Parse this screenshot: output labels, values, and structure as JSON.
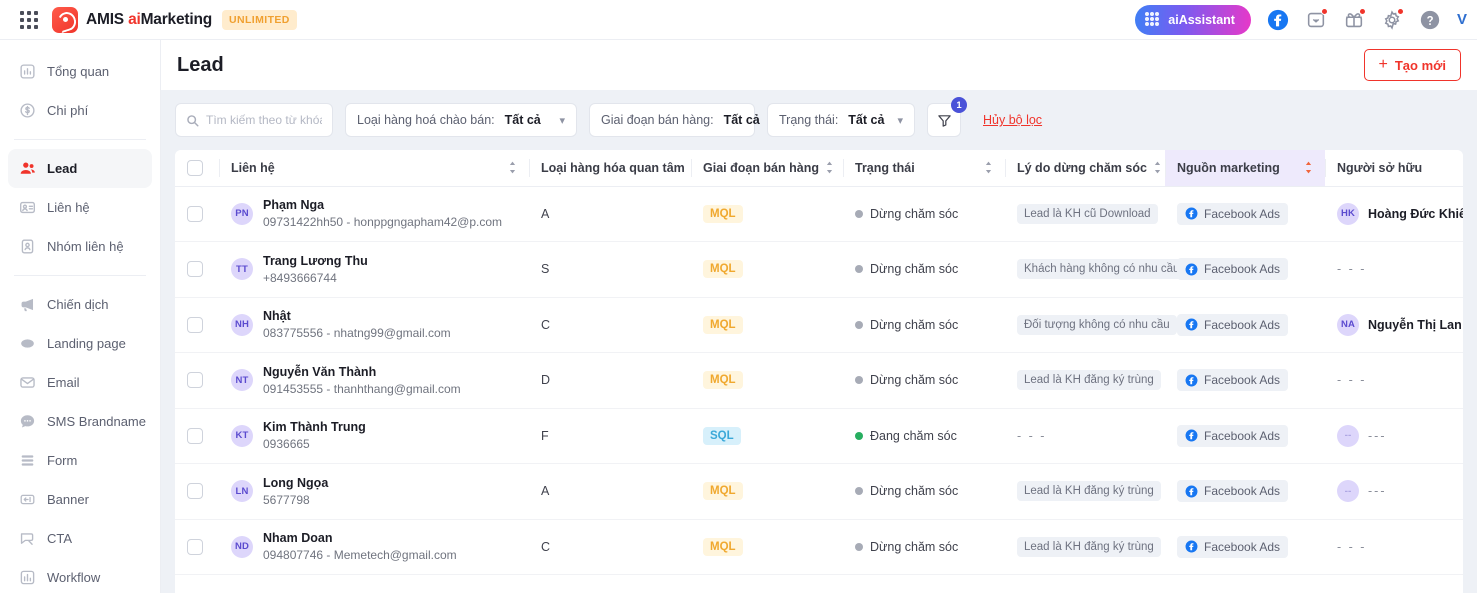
{
  "topbar": {
    "grid_icon": "apps-grid-icon",
    "brand_amis": "AMIS ",
    "brand_ai": "ai",
    "brand_marketing": "Marketing",
    "plan_badge": "UNLIMITED",
    "assistant_label": "aiAssistant",
    "icons": [
      "facebook-icon",
      "inbox-icon",
      "gift-icon",
      "gear-icon",
      "help-icon"
    ],
    "user_initial": "V"
  },
  "sidebar": {
    "items": [
      {
        "label": "Tổng quan",
        "icon": "chart-bar-icon",
        "active": false
      },
      {
        "label": "Chi phí",
        "icon": "dollar-circle-icon",
        "active": false
      },
      {
        "label": "Lead",
        "icon": "users-icon",
        "active": true
      },
      {
        "label": "Liên hệ",
        "icon": "contact-card-icon",
        "active": false
      },
      {
        "label": "Nhóm liên hệ",
        "icon": "address-book-icon",
        "active": false
      },
      {
        "label": "Chiến dịch",
        "icon": "megaphone-icon",
        "active": false
      },
      {
        "label": "Landing page",
        "icon": "globe-icon",
        "active": false
      },
      {
        "label": "Email",
        "icon": "envelope-icon",
        "active": false
      },
      {
        "label": "SMS Brandname",
        "icon": "chat-bubble-icon",
        "active": false
      },
      {
        "label": "Form",
        "icon": "form-lines-icon",
        "active": false
      },
      {
        "label": "Banner",
        "icon": "banner-icon",
        "active": false
      },
      {
        "label": "CTA",
        "icon": "cta-cursor-icon",
        "active": false
      },
      {
        "label": "Workflow",
        "icon": "workflow-icon",
        "active": false
      }
    ]
  },
  "page": {
    "title": "Lead",
    "create_button": "Tạo mới",
    "create_plus": "+"
  },
  "filters": {
    "search_placeholder": "Tìm kiếm theo từ khóa",
    "search_value": "",
    "selects": [
      {
        "label": "Loại hàng hoá chào bán:",
        "value": "Tất cả"
      },
      {
        "label": "Giai đoạn bán hàng:",
        "value": "Tất cả"
      },
      {
        "label": "Trạng thái:",
        "value": "Tất cả"
      }
    ],
    "filter_badge": "1",
    "clear_label": "Hủy bộ lọc"
  },
  "table": {
    "columns": [
      "Liên hệ",
      "Loại hàng hóa quan tâm",
      "Giai đoạn bán hàng",
      "Trạng thái",
      "Lý do dừng chăm sóc",
      "Nguồn marketing",
      "Người sở hữu"
    ],
    "highlighted_column": "Nguồn marketing",
    "rows": [
      {
        "initials": "PN",
        "name": "Phạm Nga",
        "sub": "09731422hh50 - honppgngapham42@p.com",
        "product": "A",
        "stage": "MQL",
        "stage_type": "mql",
        "status": "Dừng chăm sóc",
        "status_color": "#a7abb6",
        "reason": "Lead là KH cũ Download",
        "source": "Facebook Ads",
        "owner": "Hoàng Đức Khiêm",
        "owner_initials": "HK"
      },
      {
        "initials": "TT",
        "name": "Trang Lương Thu",
        "sub": "+8493666744",
        "product": "S",
        "stage": "MQL",
        "stage_type": "mql",
        "status": "Dừng chăm sóc",
        "status_color": "#a7abb6",
        "reason": "Khách hàng không có nhu cầu",
        "source": "Facebook Ads",
        "owner": "- - -",
        "owner_initials": ""
      },
      {
        "initials": "NH",
        "name": "Nhật",
        "sub": "083775556 - nhatng99@gmail.com",
        "product": "C",
        "stage": "MQL",
        "stage_type": "mql",
        "status": "Dừng chăm sóc",
        "status_color": "#a7abb6",
        "reason": "Đối tượng không có nhu cầu",
        "source": "Facebook Ads",
        "owner": "Nguyễn Thị Lan Anh",
        "owner_initials": "NA"
      },
      {
        "initials": "NT",
        "name": "Nguyễn Văn Thành",
        "sub": "091453555 - thanhthang@gmail.com",
        "product": "D",
        "stage": "MQL",
        "stage_type": "mql",
        "status": "Dừng chăm sóc",
        "status_color": "#a7abb6",
        "reason": "Lead là KH đăng ký trùng",
        "source": "Facebook Ads",
        "owner": "- - -",
        "owner_initials": ""
      },
      {
        "initials": "KT",
        "name": "Kim Thành Trung",
        "sub": "0936665",
        "product": "F",
        "stage": "SQL",
        "stage_type": "sql",
        "status": "Đang chăm sóc",
        "status_color": "#27ae60",
        "reason": "- - -",
        "source": "Facebook Ads",
        "owner": "---",
        "owner_initials": "--"
      },
      {
        "initials": "LN",
        "name": "Long Ngọa",
        "sub": "5677798",
        "product": "A",
        "stage": "MQL",
        "stage_type": "mql",
        "status": "Dừng chăm sóc",
        "status_color": "#a7abb6",
        "reason": "Lead là KH đăng ký trùng",
        "source": "Facebook Ads",
        "owner": "---",
        "owner_initials": "--"
      },
      {
        "initials": "ND",
        "name": "Nham Doan",
        "sub": "094807746 - Memetech@gmail.com",
        "product": "C",
        "stage": "MQL",
        "stage_type": "mql",
        "status": "Dừng chăm sóc",
        "status_color": "#a7abb6",
        "reason": "Lead là KH đăng ký trùng",
        "source": "Facebook Ads",
        "owner": "- - -",
        "owner_initials": ""
      }
    ]
  },
  "colors": {
    "brand_red": "#f0342b",
    "accent_purple": "#4a52d8",
    "highlight_col": "#eeeafc",
    "page_bg": "#eef1f6"
  }
}
